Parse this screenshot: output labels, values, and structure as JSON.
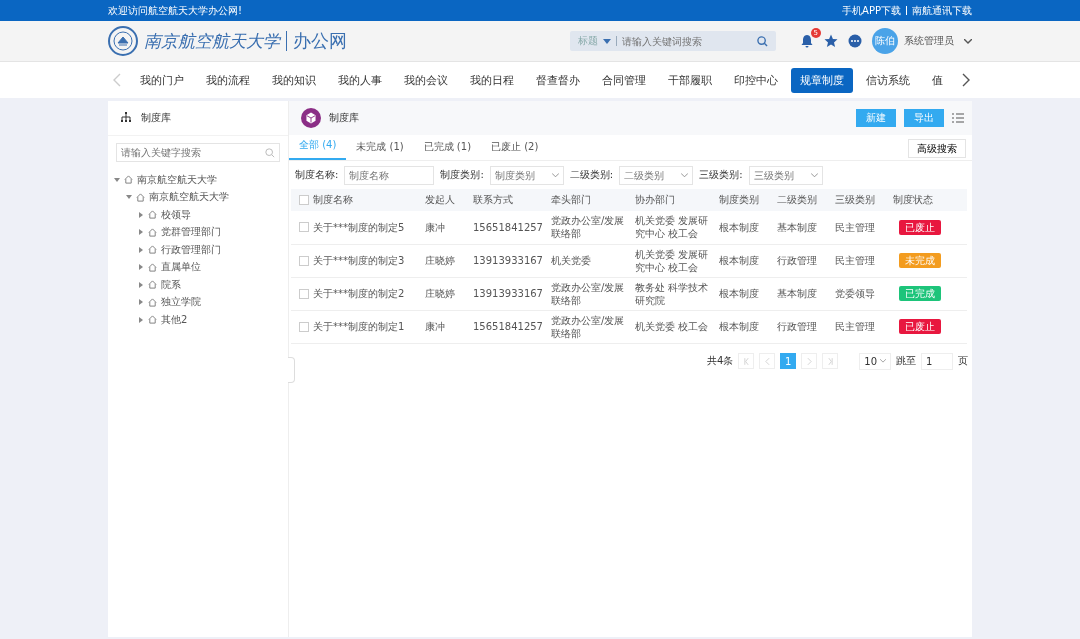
{
  "top_bar": {
    "welcome": "欢迎访问航空航天大学办公网!",
    "links": [
      "手机APP下载",
      "南航通讯下载"
    ]
  },
  "header": {
    "logo_text": "南京航空航天大学",
    "site_name": "办公网",
    "search_scope": "标题",
    "search_placeholder": "请输入关键词搜索",
    "notification_count": "5",
    "avatar_text": "陈伯",
    "user_name": "系统管理员"
  },
  "nav": [
    {
      "label": "我的门户",
      "selected": false
    },
    {
      "label": "我的流程",
      "selected": false
    },
    {
      "label": "我的知识",
      "selected": false
    },
    {
      "label": "我的人事",
      "selected": false
    },
    {
      "label": "我的会议",
      "selected": false
    },
    {
      "label": "我的日程",
      "selected": false
    },
    {
      "label": "督查督办",
      "selected": false
    },
    {
      "label": "合同管理",
      "selected": false
    },
    {
      "label": "干部履职",
      "selected": false
    },
    {
      "label": "印控中心",
      "selected": false
    },
    {
      "label": "规章制度",
      "selected": true
    },
    {
      "label": "信访系统",
      "selected": false
    },
    {
      "label": "值",
      "selected": false
    }
  ],
  "sidebar": {
    "title": "制度库",
    "search_placeholder": "请输入关键字搜索",
    "tree": [
      {
        "label": "南京航空航天大学",
        "expanded": true,
        "children": [
          {
            "label": "南京航空航天大学",
            "expanded": true,
            "children": [
              {
                "label": "校领导",
                "expanded": false
              },
              {
                "label": "党群管理部门",
                "expanded": false
              },
              {
                "label": "行政管理部门",
                "expanded": false
              },
              {
                "label": "直属单位",
                "expanded": false
              },
              {
                "label": "院系",
                "expanded": false
              },
              {
                "label": "独立学院",
                "expanded": false
              },
              {
                "label": "其他2",
                "expanded": false
              }
            ]
          }
        ]
      }
    ]
  },
  "main": {
    "title": "制度库",
    "buttons": [
      "新建",
      "导出"
    ],
    "advanced_search": "高级搜索",
    "tabs": [
      {
        "label": "全部 (4)",
        "selected": true
      },
      {
        "label": "未完成 (1)",
        "selected": false
      },
      {
        "label": "已完成 (1)",
        "selected": false
      },
      {
        "label": "已废止 (2)",
        "selected": false
      }
    ],
    "filters": [
      {
        "kind": "input",
        "label": "制度名称:",
        "placeholder": "制度名称"
      },
      {
        "kind": "select",
        "label": "制度类别:",
        "placeholder": "制度类别"
      },
      {
        "kind": "select",
        "label": "二级类别:",
        "placeholder": "二级类别"
      },
      {
        "kind": "select",
        "label": "三级类别:",
        "placeholder": "三级类别"
      }
    ],
    "table": {
      "select_all_checked": false,
      "columns": [
        "制度名称",
        "发起人",
        "联系方式",
        "牵头部门",
        "协办部门",
        "制度类别",
        "二级类别",
        "三级类别",
        "制度状态"
      ],
      "rows": [
        {
          "checked": false,
          "cells": [
            "关于***制度的制定5",
            "康冲",
            "15651841257",
            "党政办公室/发展联络部",
            "机关党委 发展研究中心 校工会",
            "根本制度",
            "基本制度",
            "民主管理"
          ],
          "status": "已废止",
          "color": "#e8173f"
        },
        {
          "checked": false,
          "cells": [
            "关于***制度的制定3",
            "庄晓婷",
            "13913933167",
            "机关党委",
            "机关党委 发展研究中心 校工会",
            "根本制度",
            "行政管理",
            "民主管理"
          ],
          "status": "未完成",
          "color": "#f39c1f"
        },
        {
          "checked": false,
          "cells": [
            "关于***制度的制定2",
            "庄晓婷",
            "13913933167",
            "党政办公室/发展联络部",
            "教务处 科学技术研究院",
            "根本制度",
            "基本制度",
            "党委领导"
          ],
          "status": "已完成",
          "color": "#1dc47a"
        },
        {
          "checked": false,
          "cells": [
            "关于***制度的制定1",
            "康冲",
            "15651841257",
            "党政办公室/发展联络部",
            "机关党委 校工会",
            "根本制度",
            "行政管理",
            "民主管理"
          ],
          "status": "已废止",
          "color": "#e8173f"
        }
      ]
    },
    "pagination": {
      "total": "共4条",
      "pages": [
        {
          "label": "1",
          "selected": true
        }
      ],
      "page_size": "10",
      "jump_label": "跳至",
      "jump_value": "1",
      "page_unit": "页"
    }
  }
}
